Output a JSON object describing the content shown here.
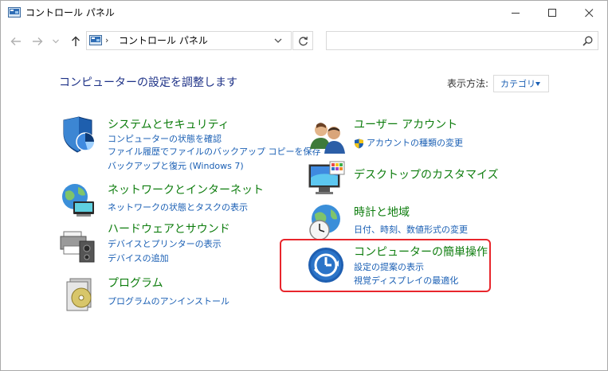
{
  "window": {
    "title": "コントロール パネル",
    "icon": "control-panel-icon"
  },
  "navigation": {
    "address_separator": "›",
    "address_text": "コントロール パネル",
    "search_placeholder": ""
  },
  "main": {
    "heading": "コンピューターの設定を調整します",
    "view_by_label": "表示方法:",
    "view_by_value": "カテゴリ"
  },
  "categories": [
    {
      "title": "システムとセキュリティ",
      "icon": "shield-icon",
      "links": [
        "コンピューターの状態を確認",
        "ファイル履歴でファイルのバックアップ コピーを保存",
        "バックアップと復元 (Windows 7)"
      ]
    },
    {
      "title": "ネットワークとインターネット",
      "icon": "network-globe-icon",
      "links": [
        "ネットワークの状態とタスクの表示"
      ]
    },
    {
      "title": "ハードウェアとサウンド",
      "icon": "printer-speaker-icon",
      "links": [
        "デバイスとプリンターの表示",
        "デバイスの追加"
      ]
    },
    {
      "title": "プログラム",
      "icon": "programs-disc-icon",
      "links": [
        "プログラムのアンインストール"
      ]
    },
    {
      "title": "ユーザー アカウント",
      "icon": "users-icon",
      "links": [
        "アカウントの種類の変更"
      ]
    },
    {
      "title": "デスクトップのカスタマイズ",
      "icon": "monitor-palette-icon",
      "links": []
    },
    {
      "title": "時計と地域",
      "icon": "clock-globe-icon",
      "links": [
        "日付、時刻、数値形式の変更"
      ]
    },
    {
      "title": "コンピューターの簡単操作",
      "icon": "ease-of-access-icon",
      "links": [
        "設定の提案の表示",
        "視覚ディスプレイの最適化"
      ]
    }
  ],
  "colors": {
    "category_title": "#0e7d0e",
    "link": "#1a5fb4",
    "heading": "#1e3287",
    "highlight": "#e8262c"
  }
}
